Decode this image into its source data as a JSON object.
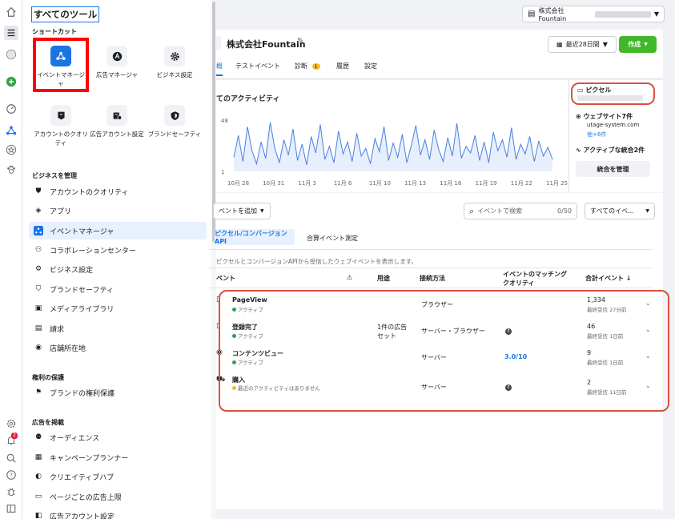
{
  "sidebar": {
    "title": "すべてのツール",
    "shortcuts_heading": "ショートカット",
    "shortcuts": [
      {
        "label": "イベントマネージャ",
        "icon": "event-manager-icon",
        "selected": true
      },
      {
        "label": "広告マネージャ",
        "icon": "ads-manager-icon"
      },
      {
        "label": "ビジネス設定",
        "icon": "gear-icon"
      },
      {
        "label": "アカウントのクオリティ",
        "icon": "account-quality-icon"
      },
      {
        "label": "広告アカウント設定",
        "icon": "ad-account-settings-icon"
      },
      {
        "label": "ブランドセーフティ",
        "icon": "brand-safety-icon"
      }
    ],
    "manage_heading": "ビジネスを管理",
    "manage_items": [
      "アカウントのクオリティ",
      "アプリ",
      "イベントマネージャ",
      "コラボレーションセンター",
      "ビジネス設定",
      "ブランドセーフティ",
      "メディアライブラリ",
      "請求",
      "店舗所在地"
    ],
    "rights_heading": "権利の保護",
    "rights_items": [
      "ブランドの権利保護"
    ],
    "ads_heading": "広告を掲載",
    "ads_items": [
      "オーディエンス",
      "キャンペーンプランナー",
      "クリエイティブハブ",
      "ページごとの広告上限",
      "広告アカウント設定"
    ]
  },
  "rail": {
    "notification_badge": "2"
  },
  "top": {
    "account_name": "株式会社Fountain"
  },
  "header": {
    "title": "株式会社Fountain",
    "date_range": "最近28日間",
    "create": "作成",
    "tabs": [
      {
        "label": "概",
        "active": true
      },
      {
        "label": "テストイベント"
      },
      {
        "label": "診断",
        "badge": "1"
      },
      {
        "label": "履歴"
      },
      {
        "label": "設定"
      }
    ]
  },
  "activity": {
    "title": "すべてのアクティビティ",
    "chart_title": "てのアクティビティ"
  },
  "chart_data": {
    "type": "line",
    "title": "",
    "ylim": [
      1,
      48
    ],
    "y_ticks": [
      "48",
      "1"
    ],
    "x_ticks": [
      "10月 28",
      "10月 31",
      "11月 3",
      "11月 6",
      "11月 10",
      "11月 13",
      "11月 16",
      "11月 19",
      "11月 22",
      "11月 25"
    ],
    "values": [
      14,
      34,
      10,
      42,
      20,
      8,
      28,
      13,
      46,
      22,
      9,
      30,
      16,
      40,
      11,
      26,
      7,
      33,
      18,
      44,
      12,
      24,
      9,
      38,
      17,
      28,
      10,
      36,
      15,
      22,
      8,
      31,
      19,
      42,
      11,
      27,
      14,
      35,
      9,
      25,
      43,
      16,
      30,
      12,
      39,
      21,
      10,
      32,
      15,
      45,
      13,
      24,
      18,
      34,
      11,
      28,
      9,
      37,
      20,
      30,
      14,
      41,
      12,
      26,
      17,
      33,
      10,
      29,
      15,
      23,
      12
    ]
  },
  "pixel": {
    "label": "ピクセル",
    "website_label": "ウェブサイト7件",
    "website_url": "utage-system.com",
    "website_more": "他+6件",
    "integrations": "アクティブな統合2件",
    "manage_button": "統合を管理"
  },
  "toolbar": {
    "add_event": "ベントを追加",
    "search_placeholder": "イベントで検索",
    "search_count": "0/50",
    "filter": "すべてのイベ..."
  },
  "subtabs": [
    {
      "label": "ピクセル/コンバージョンAPI",
      "active": true
    },
    {
      "label": "合算イベント測定"
    }
  ],
  "description": "ピクセルとコンバージョンAPIから受信したウェブイベントを表示します。",
  "table": {
    "headers": {
      "event": "ベント",
      "warning": "⚠",
      "usage": "用途",
      "connection": "接続方法",
      "quality_line1": "イベントのマッチング",
      "quality_line2": "クオリティ",
      "total": "合計イベント ↓"
    },
    "rows": [
      {
        "name": "PageView",
        "status": "アクティブ",
        "status_color": "#31a24c",
        "usage": "",
        "connection": "ブラウザー",
        "quality": "",
        "total": "1,334",
        "last": "最終受信 27分前"
      },
      {
        "name": "登録完了",
        "status": "アクティブ",
        "status_color": "#31a24c",
        "usage": "1件の広告セット",
        "connection": "サーバー・ブラウザー",
        "quality": "!",
        "total": "46",
        "last": "最終受信 1日前"
      },
      {
        "name": "コンテンツビュー",
        "status": "アクティブ",
        "status_color": "#31a24c",
        "usage": "",
        "connection": "サーバー",
        "quality": "3.0/10",
        "total": "9",
        "last": "最終受信 1日前"
      },
      {
        "name": "購入",
        "status": "最近のアクティビティはありません",
        "status_color": "#f7b928",
        "usage": "",
        "connection": "サーバー",
        "quality": "!",
        "total": "2",
        "last": "最終受信 11日前"
      }
    ]
  }
}
